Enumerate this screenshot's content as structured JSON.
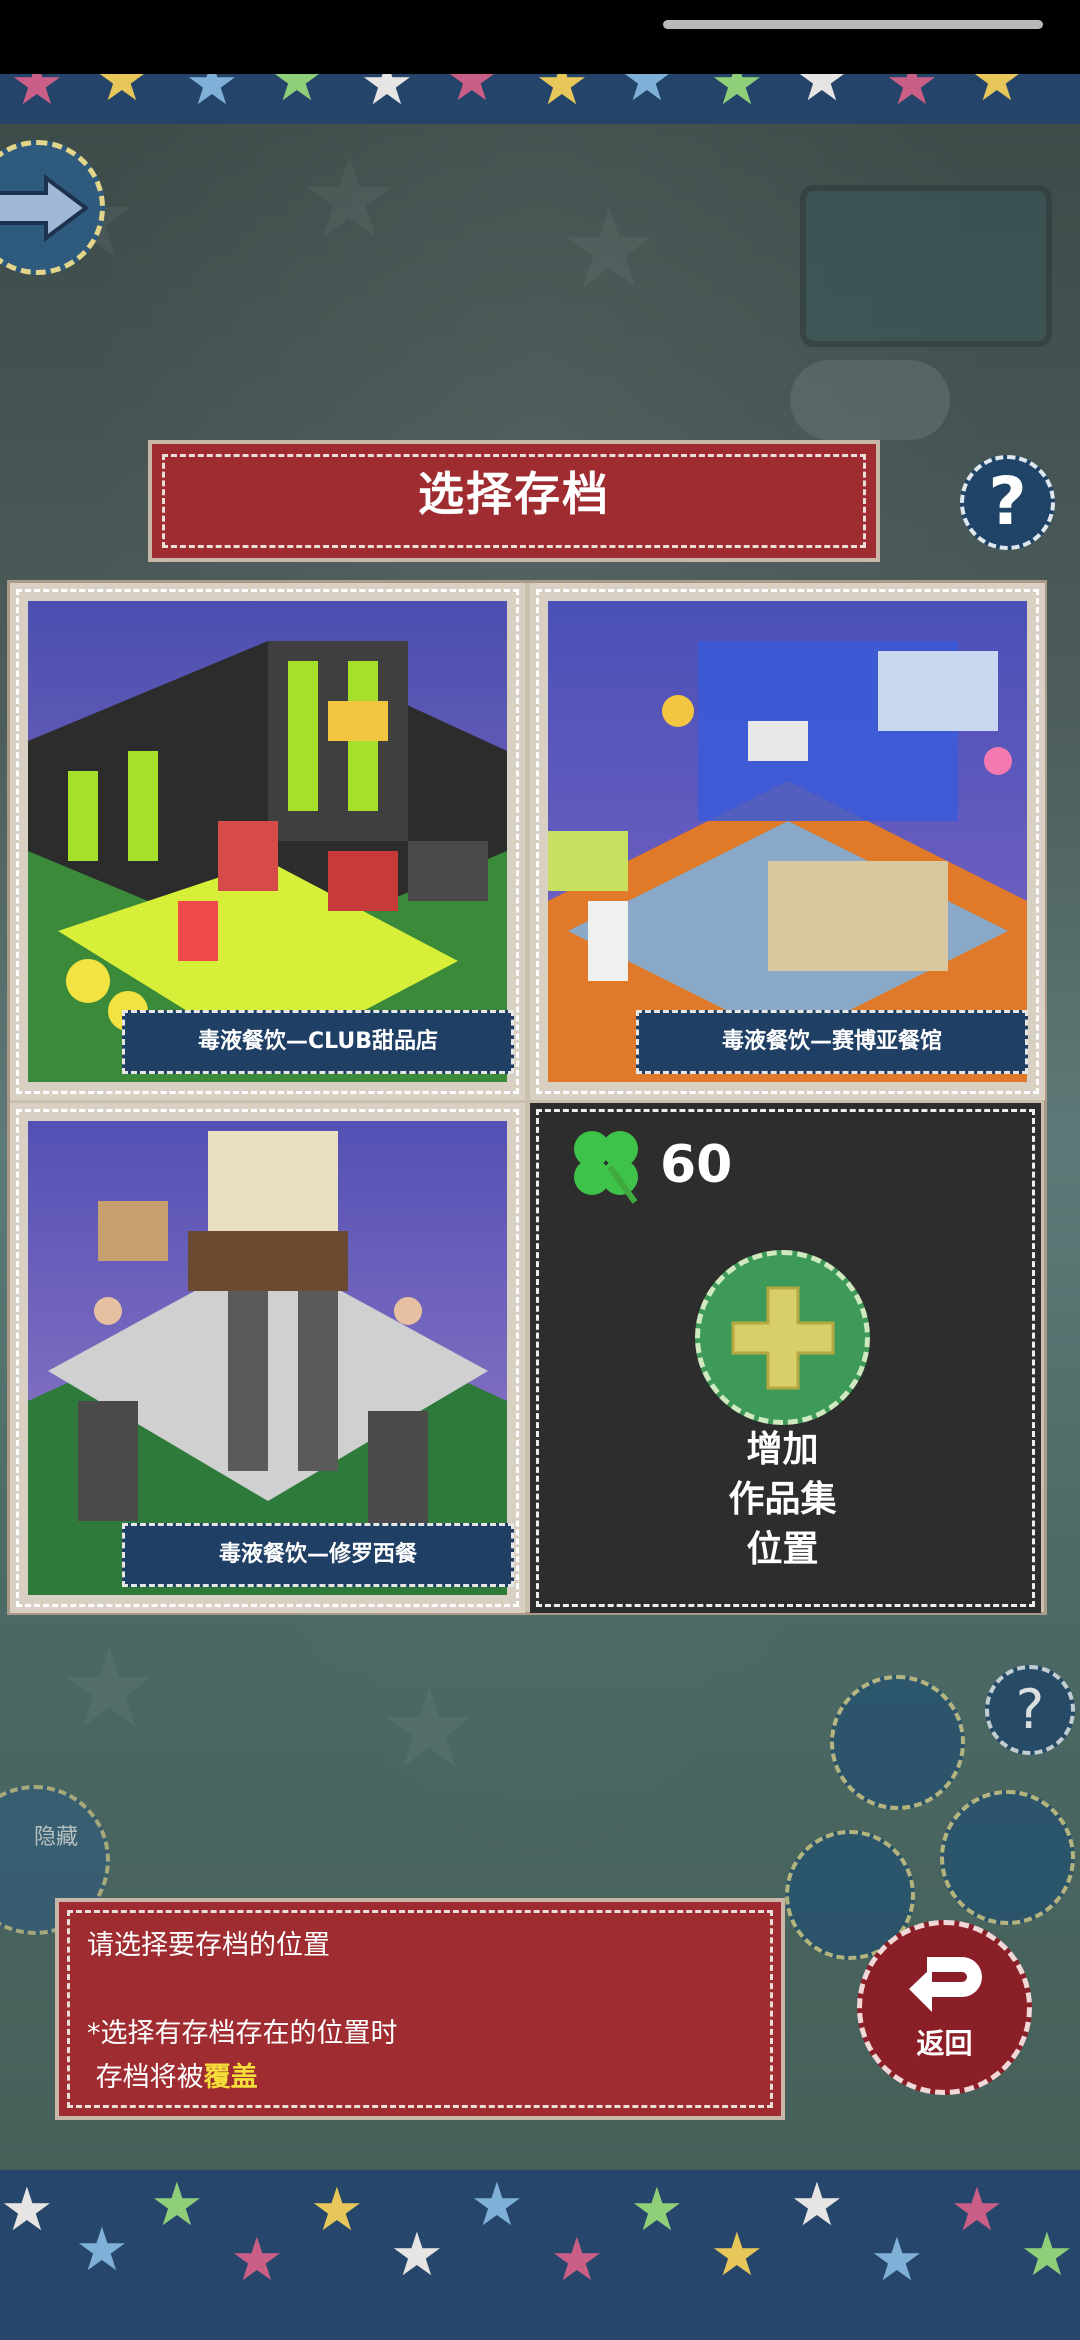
{
  "title": "选择存档",
  "slots": [
    {
      "label": "毒液餐饮—CLUB甜品店"
    },
    {
      "label": "毒液餐饮—赛博亚餐馆"
    },
    {
      "label": "毒液餐饮—修罗西餐"
    }
  ],
  "new_slot": {
    "clover_count": "60",
    "add_line1": "增加",
    "add_line2": "作品集",
    "add_line3": "位置"
  },
  "info": {
    "line1": "请选择要存档的位置",
    "line2": "*选择有存档存在的位置时",
    "line3_prefix": "存档将被",
    "line3_highlight": "覆盖"
  },
  "back_label": "返回",
  "help_label": "?",
  "hide_label": "隐藏",
  "icons": {
    "arrow": "arrow-right-icon",
    "clover": "clover-icon",
    "plus": "plus-icon",
    "back": "return-arrow-icon",
    "help": "question-icon"
  },
  "colors": {
    "banner_red": "#9f2c31",
    "label_blue": "#1f3f64",
    "plus_green": "#3e9a58",
    "highlight_yellow": "#f4de39"
  }
}
